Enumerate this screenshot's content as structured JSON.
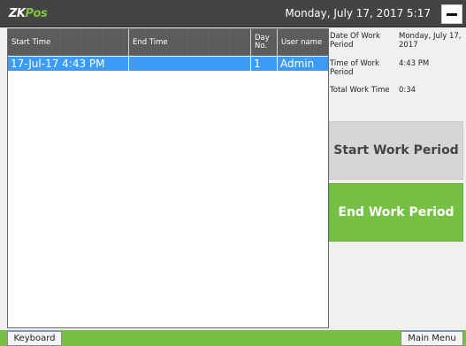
{
  "header": {
    "logo_part1": "ZK",
    "logo_part2": "Pos",
    "datetime": "Monday, July 17, 2017 5:17",
    "minimize_icon": "minus-icon"
  },
  "table": {
    "columns": [
      "Start Time",
      "End Time",
      "Day No.",
      "User name"
    ],
    "rows": [
      {
        "start_time": "17-Jul-17 4:43 PM",
        "end_time": "",
        "day_no": "1",
        "user_name": "Admin",
        "selected": true
      }
    ]
  },
  "info": {
    "date_label": "Date Of Work Period",
    "date_value": "Monday, July 17, 2017",
    "time_label": "Time of Work Period",
    "time_value": "4:43 PM",
    "total_label": "Total Work Time",
    "total_value": "0:34"
  },
  "actions": {
    "start_label": "Start Work Period",
    "end_label": "End Work Period"
  },
  "footer": {
    "keyboard_label": "Keyboard",
    "main_menu_label": "Main Menu"
  },
  "colors": {
    "title_bar": "#444444",
    "accent_green": "#76c043",
    "selection_blue": "#3c9bf5",
    "disabled_gray": "#d6d6d6"
  }
}
